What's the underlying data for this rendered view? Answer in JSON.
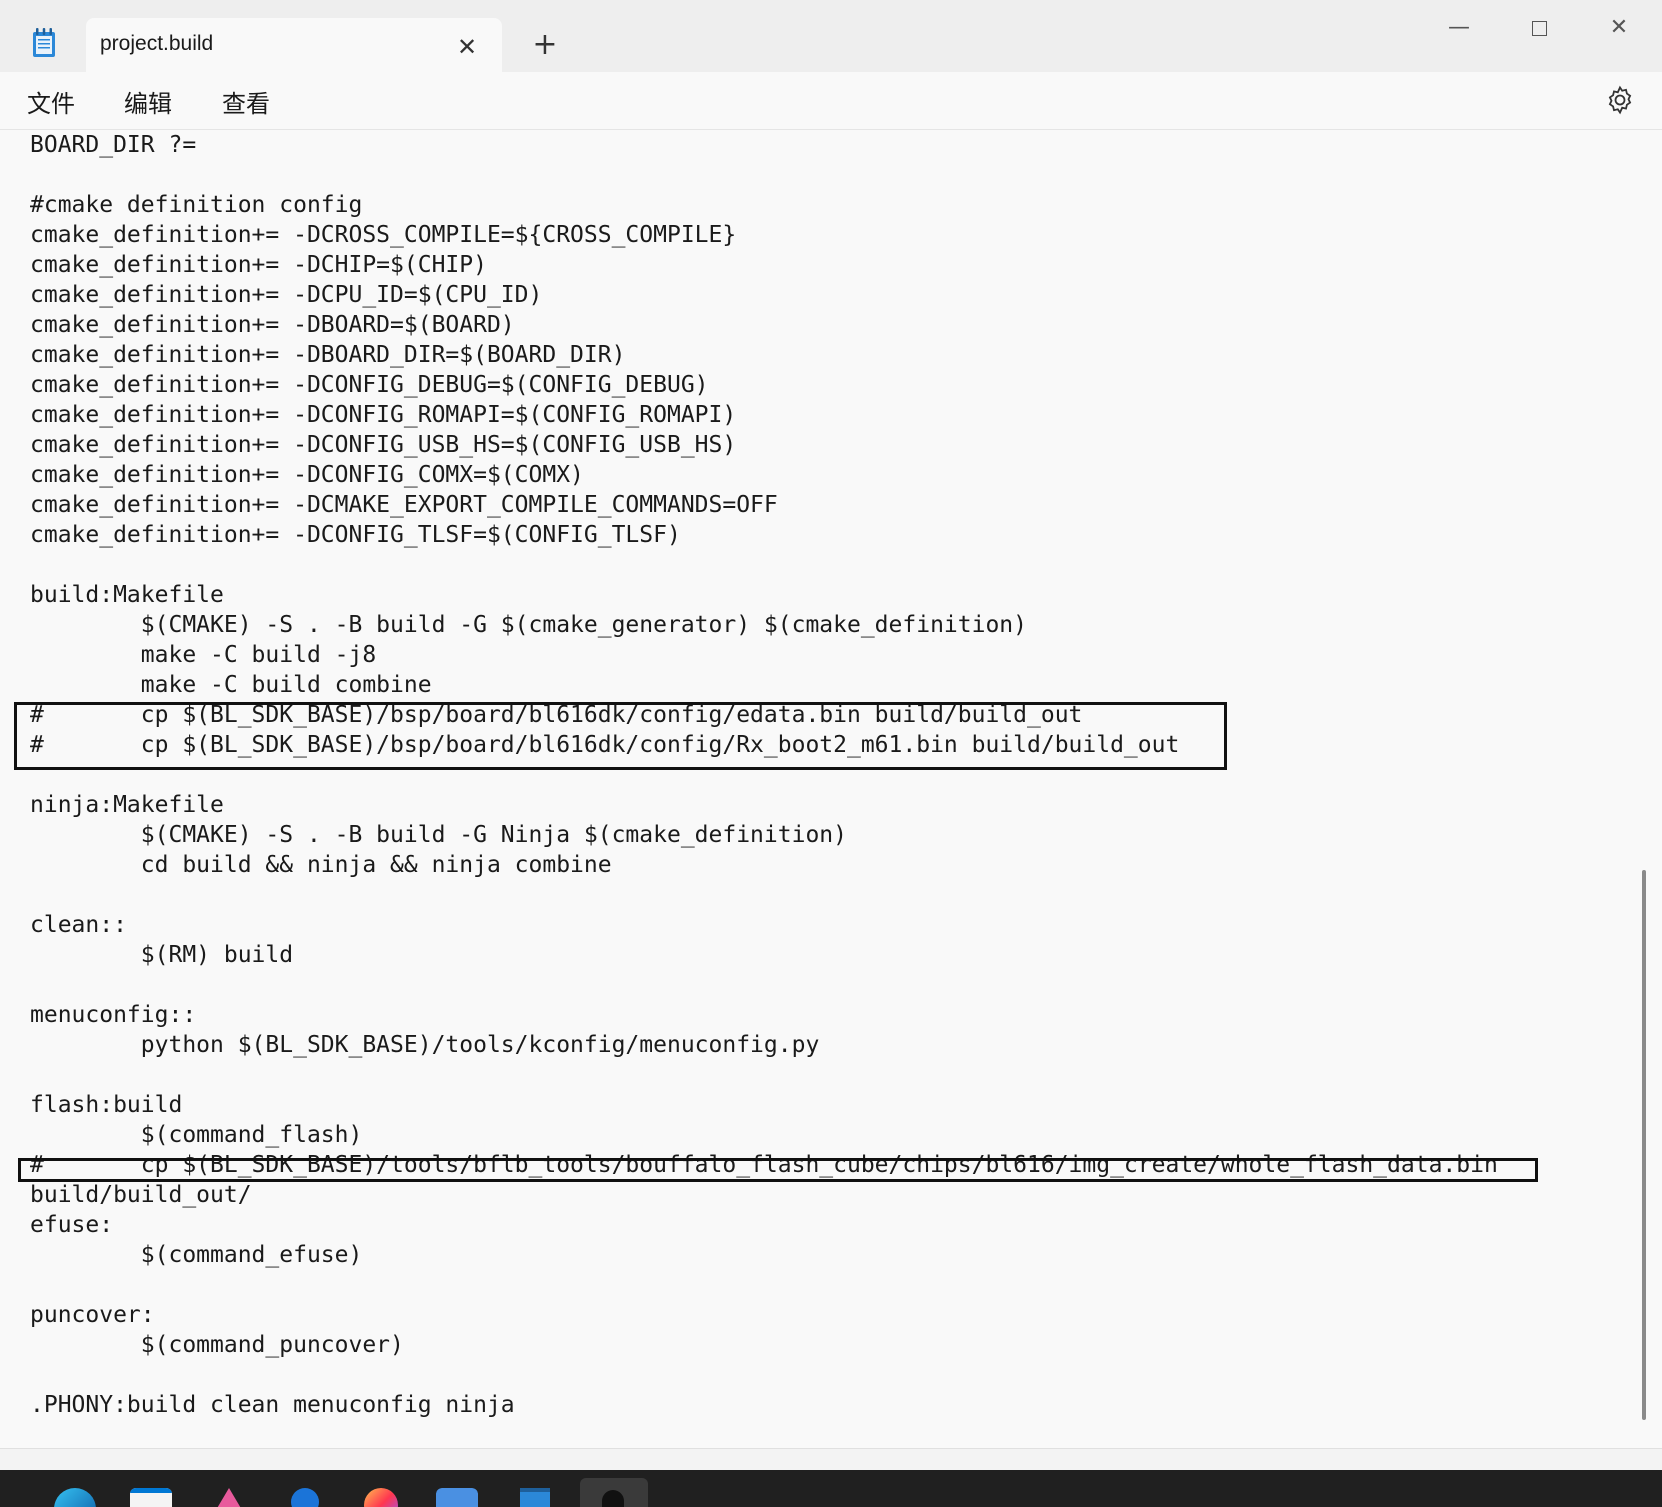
{
  "window": {
    "tab_title": "project.build",
    "tab_close_glyph": "✕",
    "new_tab_glyph": "+",
    "minimize_glyph": "—",
    "close_glyph": "✕"
  },
  "icons": {
    "app": "notepad-icon",
    "settings": "gear-icon"
  },
  "menu": {
    "file": "文件",
    "edit": "编辑",
    "view": "查看"
  },
  "editor": {
    "lines": [
      "BOARD_DIR ?=",
      "",
      "#cmake definition config",
      "cmake_definition+= -DCROSS_COMPILE=${CROSS_COMPILE}",
      "cmake_definition+= -DCHIP=$(CHIP)",
      "cmake_definition+= -DCPU_ID=$(CPU_ID)",
      "cmake_definition+= -DBOARD=$(BOARD)",
      "cmake_definition+= -DBOARD_DIR=$(BOARD_DIR)",
      "cmake_definition+= -DCONFIG_DEBUG=$(CONFIG_DEBUG)",
      "cmake_definition+= -DCONFIG_ROMAPI=$(CONFIG_ROMAPI)",
      "cmake_definition+= -DCONFIG_USB_HS=$(CONFIG_USB_HS)",
      "cmake_definition+= -DCONFIG_COMX=$(COMX)",
      "cmake_definition+= -DCMAKE_EXPORT_COMPILE_COMMANDS=OFF",
      "cmake_definition+= -DCONFIG_TLSF=$(CONFIG_TLSF)",
      "",
      "build:Makefile",
      "        $(CMAKE) -S . -B build -G $(cmake_generator) $(cmake_definition)",
      "        make -C build -j8",
      "        make -C build combine",
      "#       cp $(BL_SDK_BASE)/bsp/board/bl616dk/config/edata.bin build/build_out",
      "#       cp $(BL_SDK_BASE)/bsp/board/bl616dk/config/Rx_boot2_m61.bin build/build_out",
      "",
      "ninja:Makefile",
      "        $(CMAKE) -S . -B build -G Ninja $(cmake_definition)",
      "        cd build && ninja && ninja combine",
      "",
      "clean::",
      "        $(RM) build",
      "",
      "menuconfig::",
      "        python $(BL_SDK_BASE)/tools/kconfig/menuconfig.py",
      "",
      "flash:build",
      "        $(command_flash)",
      "#       cp $(BL_SDK_BASE)/tools/bflb_tools/bouffalo_flash_cube/chips/bl616/img_create/whole_flash_data.bin",
      "build/build_out/",
      "efuse:",
      "        $(command_efuse)",
      "",
      "puncover:",
      "        $(command_puncover)",
      "",
      ".PHONY:build clean menuconfig ninja"
    ]
  }
}
